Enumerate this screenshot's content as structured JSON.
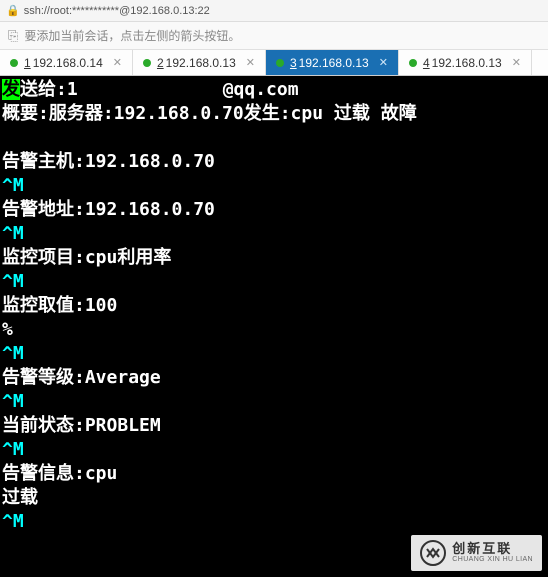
{
  "header": {
    "address": "ssh://root:***********@192.168.0.13:22"
  },
  "hint": {
    "text": "要添加当前会话，点击左侧的箭头按钮。"
  },
  "tabs": [
    {
      "num": "1",
      "label": "192.168.0.14",
      "active": false
    },
    {
      "num": "2",
      "label": "192.168.0.13",
      "active": false
    },
    {
      "num": "3",
      "label": "192.168.0.13",
      "active": true
    },
    {
      "num": "4",
      "label": "192.168.0.13",
      "active": false
    }
  ],
  "terminal": {
    "send_prefix": "发",
    "send_to_label": "送给:",
    "send_to_suffix": "@qq.com",
    "summary_label": "概要:",
    "summary_value": "服务器:192.168.0.70发生:cpu 过载 故障",
    "alert_host_label": "告警主机:",
    "alert_host_value": "192.168.0.70",
    "alert_addr_label": "告警地址:",
    "alert_addr_value": "192.168.0.70",
    "monitor_item_label": "监控项目:",
    "monitor_item_value": "cpu利用率",
    "monitor_value_label": "监控取值:",
    "monitor_value_value": "100",
    "percent": "%",
    "alert_level_label": "告警等级:",
    "alert_level_value": "Average",
    "status_label": "当前状态:",
    "status_value": "PROBLEM",
    "alert_info_label": "告警信息:",
    "alert_info_value": "cpu",
    "overload": "过载",
    "ctrl_m": "^M"
  },
  "watermark": {
    "cn": "创新互联",
    "en": "CHUANG XIN HU LIAN"
  }
}
